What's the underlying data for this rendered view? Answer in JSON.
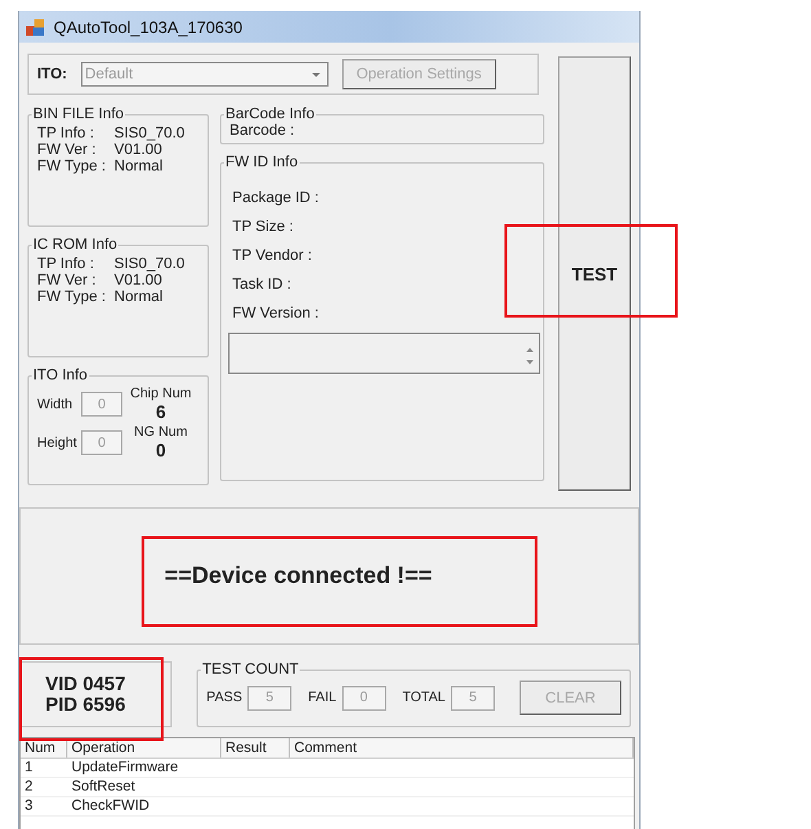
{
  "window": {
    "title": "QAutoTool_103A_170630"
  },
  "ito": {
    "label": "ITO:",
    "value": "Default",
    "disabled": true
  },
  "operation_settings": {
    "label": "Operation Settings",
    "disabled": true
  },
  "test_button": {
    "label": "TEST",
    "disabled": false
  },
  "bin_file_info": {
    "title": "BIN FILE Info",
    "rows": [
      {
        "label": "TP Info :",
        "value": "SIS0_70.0"
      },
      {
        "label": "FW Ver :",
        "value": "V01.00"
      },
      {
        "label": "FW Type :",
        "value": "Normal"
      }
    ]
  },
  "ic_rom_info": {
    "title": "IC ROM Info",
    "rows": [
      {
        "label": "TP Info :",
        "value": "SIS0_70.0"
      },
      {
        "label": "FW Ver :",
        "value": "V01.00"
      },
      {
        "label": "FW Type :",
        "value": "Normal"
      }
    ]
  },
  "ito_info": {
    "title": "ITO Info",
    "width": {
      "label": "Width",
      "value": "0"
    },
    "height": {
      "label": "Height",
      "value": "0"
    },
    "chip_num": {
      "label": "Chip Num",
      "value": "6"
    },
    "ng_num": {
      "label": "NG Num",
      "value": "0"
    }
  },
  "barcode_info": {
    "title": "BarCode Info",
    "label": "Barcode :"
  },
  "fw_id_info": {
    "title": "FW ID Info",
    "labels": [
      "Package ID :",
      "TP Size :",
      "TP Vendor :",
      "Task ID :",
      "FW Version :"
    ]
  },
  "status_message": "==Device connected !==",
  "device_ids": [
    "VID 0457",
    "PID 6596"
  ],
  "test_count": {
    "title": "TEST COUNT",
    "fields": [
      {
        "label": "PASS",
        "value": "5"
      },
      {
        "label": "FAIL",
        "value": "0"
      },
      {
        "label": "TOTAL",
        "value": "5"
      }
    ],
    "clear_button": {
      "label": "CLEAR",
      "disabled": true
    }
  },
  "table": {
    "columns": [
      "Num",
      "Operation",
      "Result",
      "Comment"
    ],
    "rows": [
      {
        "num": "1",
        "operation": "UpdateFirmware"
      },
      {
        "num": "2",
        "operation": "SoftReset"
      },
      {
        "num": "3",
        "operation": "CheckFWID"
      }
    ]
  }
}
